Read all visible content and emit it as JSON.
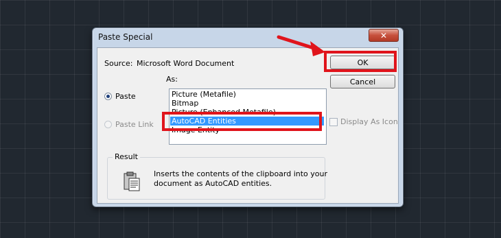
{
  "dialog": {
    "title": "Paste Special",
    "source_label": "Source:",
    "source_value": "Microsoft Word Document",
    "as_label": "As:",
    "paste_label": "Paste",
    "paste_link_label": "Paste Link",
    "paste_selected": true,
    "list_items": [
      "Picture (Metafile)",
      "Bitmap",
      "Picture (Enhanced Metafile)",
      "AutoCAD Entities",
      "Image Entity"
    ],
    "selected_item": "AutoCAD Entities",
    "ok_label": "OK",
    "cancel_label": "Cancel",
    "display_as_icon_label": "Display As Icon",
    "display_as_icon_checked": false,
    "result_label": "Result",
    "result_text_line1": "Inserts the contents of the clipboard into your",
    "result_text_line2": "document as AutoCAD entities.",
    "close_icon": "close-icon",
    "clipboard_icon": "clipboard-icon"
  },
  "annotations": {
    "highlight_color": "#e0141b",
    "arrow_icon": "red-arrow-icon"
  }
}
